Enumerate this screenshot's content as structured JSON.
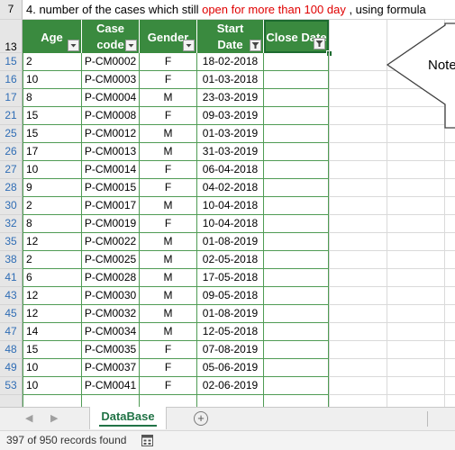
{
  "note_row": {
    "row_num": "7",
    "text_before": "4. number of the cases which still ",
    "text_red": "open for more than 100 day",
    "text_after": " , using formula"
  },
  "header_row_num": "13",
  "columns": {
    "age": "Age",
    "case_code_line1": "Case",
    "case_code_line2": "code",
    "gender": "Gender",
    "start_date_line1": "Start",
    "start_date_line2": "Date",
    "close_date": "Close Date"
  },
  "callout_text": "Note",
  "rows": [
    {
      "row": "15",
      "age": "2",
      "code": "P-CM0002",
      "gender": "F",
      "start": "18-02-2018"
    },
    {
      "row": "16",
      "age": "10",
      "code": "P-CM0003",
      "gender": "F",
      "start": "01-03-2018"
    },
    {
      "row": "17",
      "age": "8",
      "code": "P-CM0004",
      "gender": "M",
      "start": "23-03-2019"
    },
    {
      "row": "21",
      "age": "15",
      "code": "P-CM0008",
      "gender": "F",
      "start": "09-03-2019"
    },
    {
      "row": "25",
      "age": "15",
      "code": "P-CM0012",
      "gender": "M",
      "start": "01-03-2019"
    },
    {
      "row": "26",
      "age": "17",
      "code": "P-CM0013",
      "gender": "M",
      "start": "31-03-2019"
    },
    {
      "row": "27",
      "age": "10",
      "code": "P-CM0014",
      "gender": "F",
      "start": "06-04-2018"
    },
    {
      "row": "28",
      "age": "9",
      "code": "P-CM0015",
      "gender": "F",
      "start": "04-02-2018"
    },
    {
      "row": "30",
      "age": "2",
      "code": "P-CM0017",
      "gender": "M",
      "start": "10-04-2018"
    },
    {
      "row": "32",
      "age": "8",
      "code": "P-CM0019",
      "gender": "F",
      "start": "10-04-2018"
    },
    {
      "row": "35",
      "age": "12",
      "code": "P-CM0022",
      "gender": "M",
      "start": "01-08-2019"
    },
    {
      "row": "38",
      "age": "2",
      "code": "P-CM0025",
      "gender": "M",
      "start": "02-05-2018"
    },
    {
      "row": "41",
      "age": "6",
      "code": "P-CM0028",
      "gender": "M",
      "start": "17-05-2018"
    },
    {
      "row": "43",
      "age": "12",
      "code": "P-CM0030",
      "gender": "M",
      "start": "09-05-2018"
    },
    {
      "row": "45",
      "age": "12",
      "code": "P-CM0032",
      "gender": "M",
      "start": "01-08-2019"
    },
    {
      "row": "47",
      "age": "14",
      "code": "P-CM0034",
      "gender": "M",
      "start": "12-05-2018"
    },
    {
      "row": "48",
      "age": "15",
      "code": "P-CM0035",
      "gender": "F",
      "start": "07-08-2019"
    },
    {
      "row": "49",
      "age": "10",
      "code": "P-CM0037",
      "gender": "F",
      "start": "05-06-2019"
    },
    {
      "row": "53",
      "age": "10",
      "code": "P-CM0041",
      "gender": "F",
      "start": "02-06-2019"
    }
  ],
  "sheet_tab": "DataBase",
  "status": "397 of 950 records found",
  "icons": {
    "filter_dropdown": "chevron-down-icon",
    "filter_active": "filter-icon",
    "nav_prev": "triangle-left-icon",
    "nav_next": "triangle-right-icon",
    "add_sheet": "plus-circle-icon",
    "macro": "record-macro-icon"
  },
  "colors": {
    "header_bg": "#3a8a3f",
    "cell_border": "#4f9b54",
    "note_red": "#e00000",
    "tab_text": "#217346"
  }
}
